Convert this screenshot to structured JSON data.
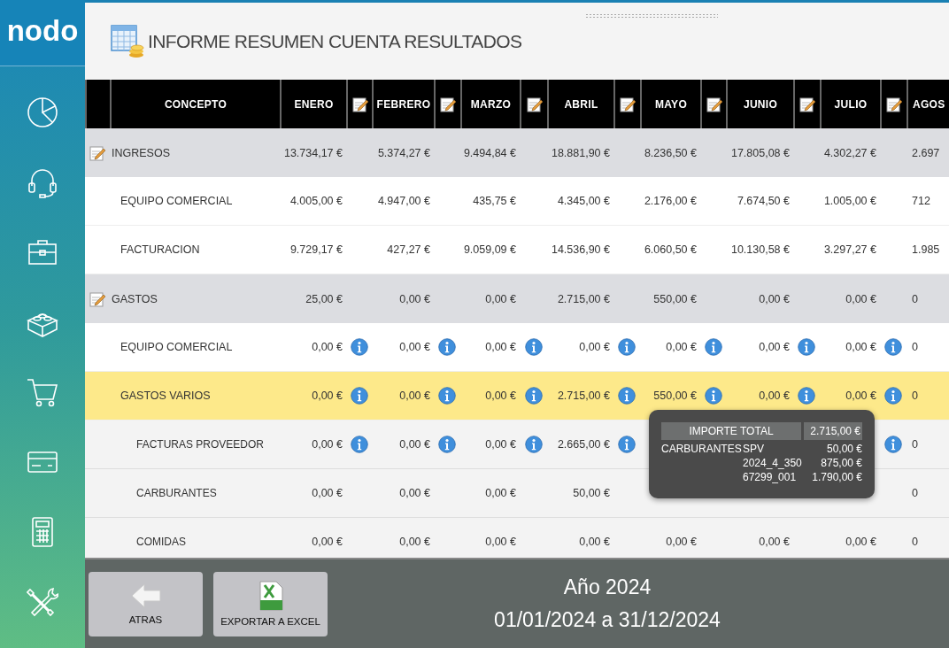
{
  "app": {
    "logo": "nodo"
  },
  "header": {
    "title": "INFORME RESUMEN CUENTA RESULTADOS"
  },
  "table": {
    "concept_label": "CONCEPTO",
    "months": [
      "ENERO",
      "FEBRERO",
      "MARZO",
      "ABRIL",
      "MAYO",
      "JUNIO",
      "JULIO",
      "AGOS"
    ],
    "rows": [
      {
        "label": "INGRESOS",
        "kind": "group",
        "highlighted": false,
        "values": [
          {
            "text": "13.734,17 €",
            "info": false
          },
          {
            "text": "5.374,27 €",
            "info": false
          },
          {
            "text": "9.494,84 €",
            "info": false
          },
          {
            "text": "18.881,90 €",
            "info": false
          },
          {
            "text": "8.236,50 €",
            "info": false
          },
          {
            "text": "17.805,08 €",
            "info": false
          },
          {
            "text": "4.302,27 €",
            "info": false
          },
          {
            "text": "2.697"
          }
        ]
      },
      {
        "label": "EQUIPO COMERCIAL",
        "kind": "item",
        "highlighted": false,
        "values": [
          {
            "text": "4.005,00 €",
            "info": false
          },
          {
            "text": "4.947,00 €",
            "info": false
          },
          {
            "text": "435,75 €",
            "info": false
          },
          {
            "text": "4.345,00 €",
            "info": false
          },
          {
            "text": "2.176,00 €",
            "info": false
          },
          {
            "text": "7.674,50 €",
            "info": false
          },
          {
            "text": "1.005,00 €",
            "info": false
          },
          {
            "text": "712"
          }
        ]
      },
      {
        "label": "FACTURACION",
        "kind": "item",
        "highlighted": false,
        "values": [
          {
            "text": "9.729,17 €",
            "info": false
          },
          {
            "text": "427,27 €",
            "info": false
          },
          {
            "text": "9.059,09 €",
            "info": false
          },
          {
            "text": "14.536,90 €",
            "info": false
          },
          {
            "text": "6.060,50 €",
            "info": false
          },
          {
            "text": "10.130,58 €",
            "info": false
          },
          {
            "text": "3.297,27 €",
            "info": false
          },
          {
            "text": "1.985"
          }
        ]
      },
      {
        "label": "GASTOS",
        "kind": "group",
        "highlighted": false,
        "values": [
          {
            "text": "25,00 €",
            "info": false
          },
          {
            "text": "0,00 €",
            "info": false
          },
          {
            "text": "0,00 €",
            "info": false
          },
          {
            "text": "2.715,00 €",
            "info": false
          },
          {
            "text": "550,00 €",
            "info": false
          },
          {
            "text": "0,00 €",
            "info": false
          },
          {
            "text": "0,00 €",
            "info": false
          },
          {
            "text": "0"
          }
        ]
      },
      {
        "label": "EQUIPO COMERCIAL",
        "kind": "item",
        "highlighted": false,
        "values": [
          {
            "text": "0,00 €",
            "info": true
          },
          {
            "text": "0,00 €",
            "info": true
          },
          {
            "text": "0,00 €",
            "info": true
          },
          {
            "text": "0,00 €",
            "info": true
          },
          {
            "text": "0,00 €",
            "info": true
          },
          {
            "text": "0,00 €",
            "info": true
          },
          {
            "text": "0,00 €",
            "info": true
          },
          {
            "text": "0"
          }
        ]
      },
      {
        "label": "GASTOS VARIOS",
        "kind": "item",
        "highlighted": true,
        "values": [
          {
            "text": "0,00 €",
            "info": true
          },
          {
            "text": "0,00 €",
            "info": true
          },
          {
            "text": "0,00 €",
            "info": true
          },
          {
            "text": "2.715,00 €",
            "info": true
          },
          {
            "text": "550,00 €",
            "info": true
          },
          {
            "text": "0,00 €",
            "info": true
          },
          {
            "text": "0,00 €",
            "info": true
          },
          {
            "text": "0"
          }
        ]
      },
      {
        "label": "FACTURAS PROVEEDOR",
        "kind": "subitem",
        "highlighted": false,
        "values": [
          {
            "text": "0,00 €",
            "info": true
          },
          {
            "text": "0,00 €",
            "info": true
          },
          {
            "text": "0,00 €",
            "info": true
          },
          {
            "text": "2.665,00 €",
            "info": true
          },
          {
            "covered": true
          },
          {
            "covered": true
          },
          {
            "info": true
          },
          {
            "text": "0"
          }
        ]
      },
      {
        "label": "CARBURANTES",
        "kind": "subitem",
        "highlighted": false,
        "values": [
          {
            "text": "0,00 €",
            "info": false
          },
          {
            "text": "0,00 €",
            "info": false
          },
          {
            "text": "0,00 €",
            "info": false
          },
          {
            "text": "50,00 €",
            "info": false
          },
          {
            "covered": true
          },
          {
            "covered": true
          },
          {
            "covered": true
          },
          {
            "text": "0"
          }
        ]
      },
      {
        "label": "COMIDAS",
        "kind": "subitem",
        "highlighted": false,
        "values": [
          {
            "text": "0,00 €",
            "info": false
          },
          {
            "text": "0,00 €",
            "info": false
          },
          {
            "text": "0,00 €",
            "info": false
          },
          {
            "text": "0,00 €",
            "info": false
          },
          {
            "text": "0,00 €",
            "info": false
          },
          {
            "text": "0,00 €",
            "info": false
          },
          {
            "text": "0,00 €",
            "info": false
          },
          {
            "text": "0"
          }
        ]
      }
    ]
  },
  "tooltip": {
    "header_label": "IMPORTE TOTAL",
    "header_value": "2.715,00 €",
    "lines": [
      {
        "category": "CARBURANTES",
        "ref": "SPV",
        "amount": "50,00 €"
      },
      {
        "ref": "2024_4_350",
        "amount": "875,00 €"
      },
      {
        "ref": "67299_001",
        "amount": "1.790,00 €"
      }
    ]
  },
  "footer": {
    "buttons": [
      {
        "label": "ATRAS",
        "kind": "back"
      },
      {
        "label": "EXPORTAR A EXCEL",
        "kind": "excel"
      }
    ],
    "year": "Año 2024",
    "range": "01/01/2024 a 31/12/2024"
  }
}
